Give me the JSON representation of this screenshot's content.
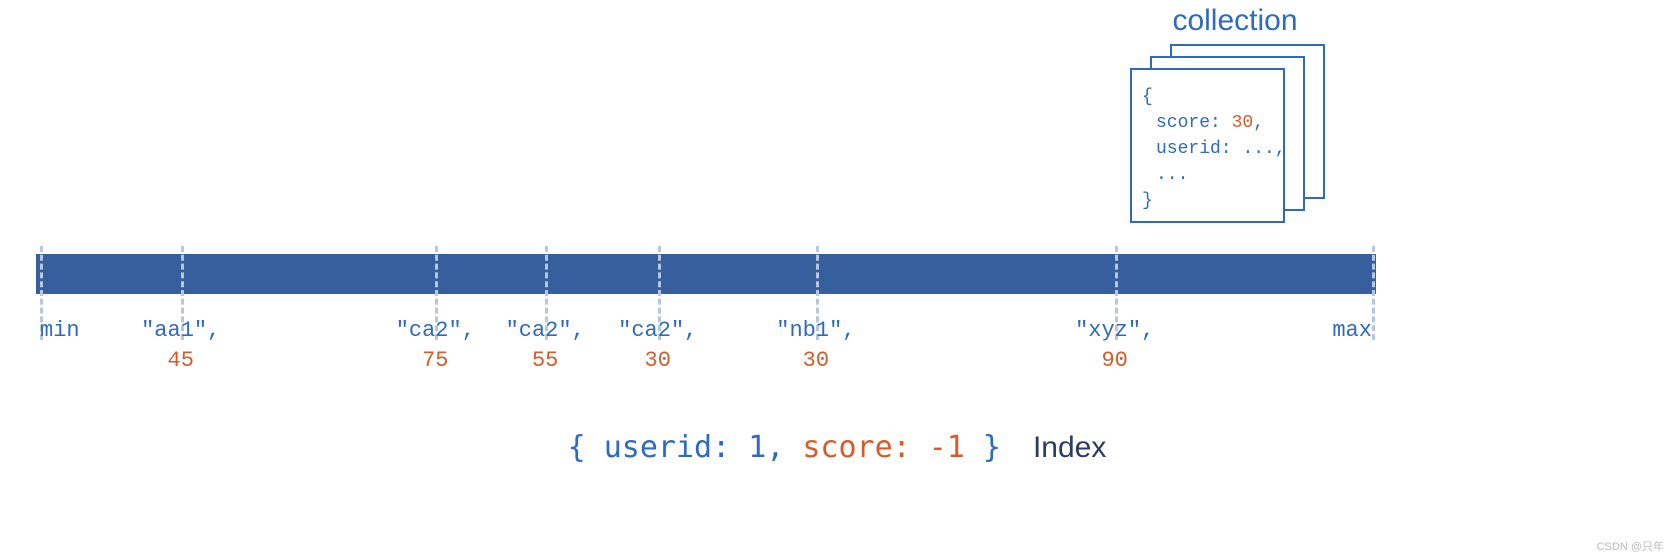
{
  "collection": {
    "title": "collection",
    "doc": {
      "brace_open": "{",
      "line1_key": "score:",
      "line1_val": "30",
      "line1_comma": ",",
      "line2_key": "userid:",
      "line2_val": "...",
      "line2_comma": ",",
      "line3": "...",
      "brace_close": "}"
    }
  },
  "bar": {
    "min": "min",
    "max": "max",
    "entries": [
      {
        "label": "\"aa1\",",
        "value": "45",
        "pos": 10.8
      },
      {
        "label": "\"ca2\",",
        "value": "75",
        "pos": 29.8
      },
      {
        "label": "\"ca2\",",
        "value": "55",
        "pos": 38.0
      },
      {
        "label": "\"ca2\",",
        "value": "30",
        "pos": 46.4
      },
      {
        "label": "\"nb1\",",
        "value": "30",
        "pos": 58.2
      },
      {
        "label": "\"xyz\",",
        "value": "90",
        "pos": 80.5
      }
    ]
  },
  "index": {
    "open": "{",
    "key1": "userid:",
    "val1": "1",
    "sep": ",",
    "key2": "score:",
    "val2": "-1",
    "close": "}",
    "word": "Index"
  },
  "watermark": "CSDN @只年"
}
